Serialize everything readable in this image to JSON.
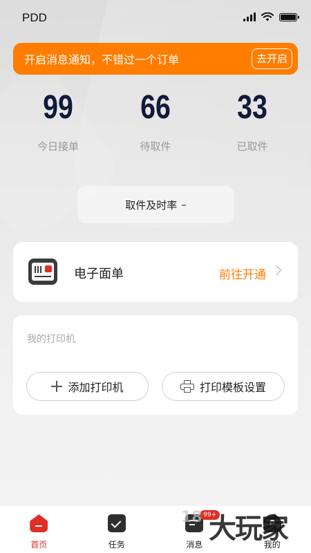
{
  "status_bar": {
    "carrier": "PDD"
  },
  "notice": {
    "text": "开启消息通知，不错过一个订单",
    "button_label": "去开启"
  },
  "stats": [
    {
      "value": "99",
      "label": "今日接单"
    },
    {
      "value": "66",
      "label": "待取件"
    },
    {
      "value": "33",
      "label": "已取件"
    }
  ],
  "pickup_rate": {
    "label": "取件及时率",
    "value": "–"
  },
  "eorder": {
    "title": "电子面单",
    "link_label": "前往开通"
  },
  "printer": {
    "title": "我的打印机",
    "add_label": "添加打印机",
    "template_label": "打印模板设置"
  },
  "tabbar": {
    "items": [
      {
        "label": "首页",
        "icon": "home-icon",
        "active": true
      },
      {
        "label": "任务",
        "icon": "task-check-icon",
        "active": false
      },
      {
        "label": "消息",
        "icon": "message-icon",
        "active": false
      },
      {
        "label": "我的",
        "icon": "profile-icon",
        "active": false
      }
    ],
    "message_badge": "99+"
  },
  "watermark": {
    "text": "大玩家",
    "sub": "18"
  },
  "colors": {
    "accent_orange": "#ff7d00",
    "brand_red": "#e02e24",
    "stat_navy": "#101a3a"
  }
}
